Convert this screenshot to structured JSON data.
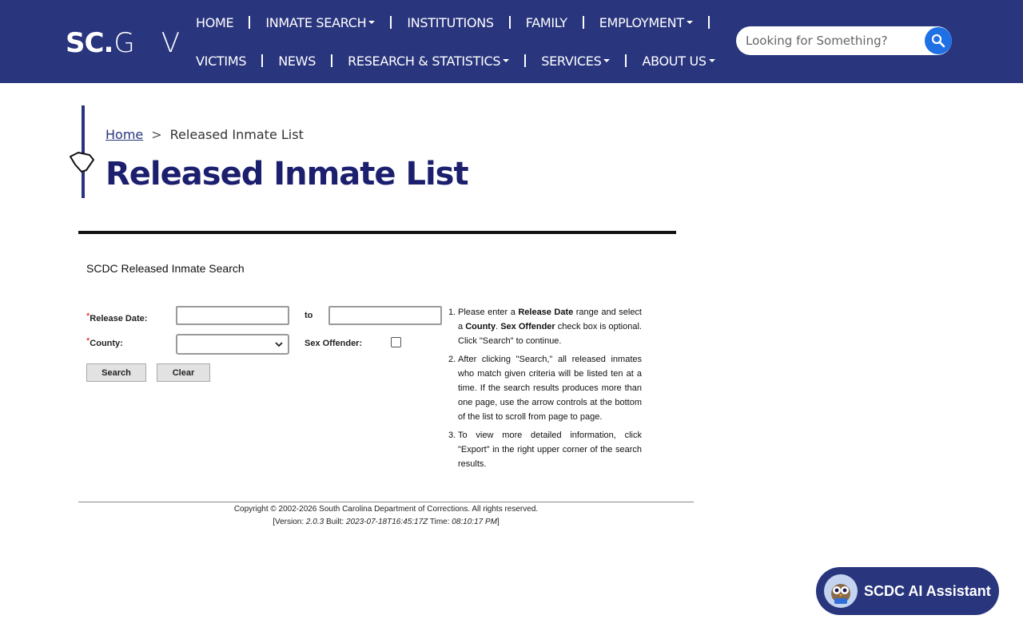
{
  "header": {
    "logo_sc": "SC",
    "logo_dot": ".",
    "logo_g": "G",
    "logo_v": "V",
    "nav_row1": [
      {
        "label": "HOME",
        "dropdown": false
      },
      {
        "label": "INMATE SEARCH",
        "dropdown": true
      },
      {
        "label": "INSTITUTIONS",
        "dropdown": false
      },
      {
        "label": "FAMILY",
        "dropdown": false
      },
      {
        "label": "EMPLOYMENT",
        "dropdown": true
      }
    ],
    "nav_row2": [
      {
        "label": "VICTIMS",
        "dropdown": false
      },
      {
        "label": "NEWS",
        "dropdown": false
      },
      {
        "label": "RESEARCH & STATISTICS",
        "dropdown": true
      },
      {
        "label": "SERVICES",
        "dropdown": true
      },
      {
        "label": "ABOUT US",
        "dropdown": true
      }
    ],
    "search_placeholder": "Looking for Something?",
    "search_icon": "search-icon"
  },
  "breadcrumb": {
    "home": "Home",
    "separator": ">",
    "current": "Released Inmate List"
  },
  "page_title": "Released Inmate List",
  "form": {
    "heading": "SCDC Released Inmate Search",
    "release_date_label": "Release Date:",
    "to_label": "to",
    "county_label": "County:",
    "required_mark": "*",
    "sex_offender_label": "Sex Offender:",
    "release_date_from": "",
    "release_date_to": "",
    "county_selected": "",
    "sex_offender_checked": false,
    "search_button": "Search",
    "clear_button": "Clear"
  },
  "instructions": [
    {
      "num": "1.",
      "parts": [
        "Please enter a ",
        "Release Date",
        " range and select a ",
        "County",
        ". ",
        "Sex Offender",
        " check box is optional. Click \"Search\" to continue."
      ]
    },
    {
      "num": "2.",
      "text": "After clicking \"Search,\" all released inmates who match given criteria will be listed ten at a time. If the search results produces more than one page, use the arrow controls at the bottom of the list to scroll from page to page."
    },
    {
      "num": "3.",
      "text": "To view more detailed information, click \"Export\" in the right upper corner of the search results."
    }
  ],
  "footer": {
    "copyright": "Copyright © 2002-2026 South Carolina Department of Corrections. All rights reserved.",
    "version_prefix": "[Version: ",
    "version": "2.0.3",
    "built_prefix": " Built: ",
    "built": "2023-07-18T16:45:17Z",
    "time_prefix": " Time: ",
    "time": "08:10:17 PM",
    "version_suffix": "]"
  },
  "assistant": {
    "label": "SCDC AI Assistant"
  },
  "colors": {
    "brand_navy": "#29357d",
    "title_navy": "#1c1f6e",
    "search_blue": "#1f6fe5",
    "required_red": "#dd0000"
  }
}
